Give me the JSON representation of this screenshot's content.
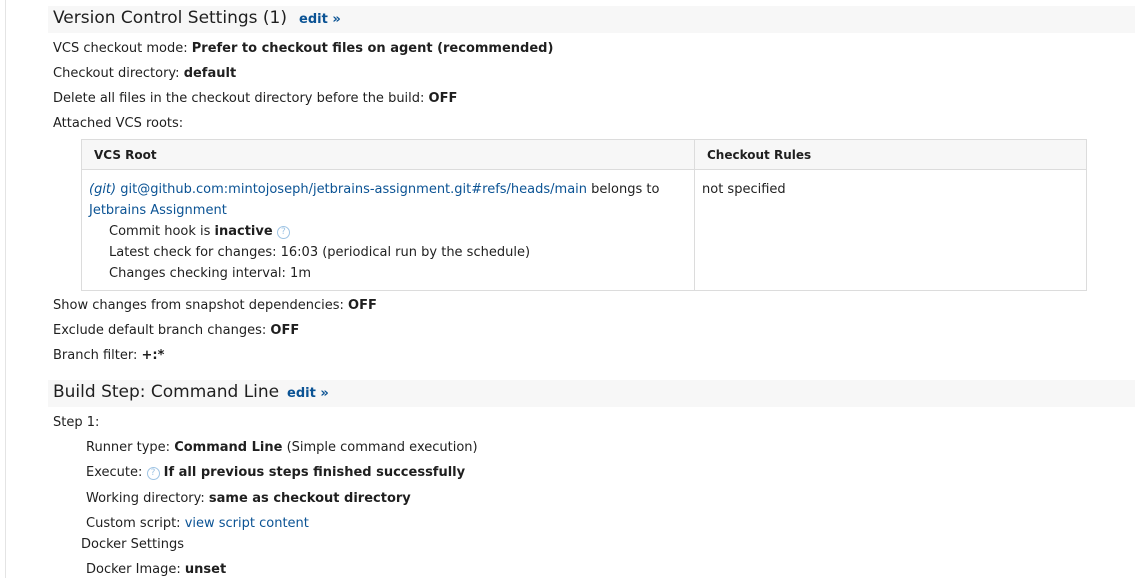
{
  "vcs_section": {
    "title": "Version Control Settings (1)",
    "edit": "edit »",
    "checkout_mode_label": "VCS checkout mode: ",
    "checkout_mode_value": "Prefer to checkout files on agent (recommended)",
    "checkout_dir_label": "Checkout directory: ",
    "checkout_dir_value": "default",
    "delete_files_label": "Delete all files in the checkout directory before the build: ",
    "delete_files_value": "OFF",
    "attached_roots_label": "Attached VCS roots:",
    "table": {
      "col_root": "VCS Root",
      "col_rules": "Checkout Rules",
      "root_type": "(git)",
      "root_url": "git@github.com:mintojoseph/jetbrains-assignment.git#refs/heads/main",
      "belongs_to": " belongs to",
      "project": "Jetbrains Assignment",
      "commit_hook_label": "Commit hook is ",
      "commit_hook_value": "inactive",
      "latest_check": "Latest check for changes: 16:03 (periodical run by the schedule)",
      "interval": "Changes checking interval: 1m",
      "checkout_rules_value": "not specified"
    },
    "snapshot_label": "Show changes from snapshot dependencies: ",
    "snapshot_value": "OFF",
    "exclude_label": "Exclude default branch changes: ",
    "exclude_value": "OFF",
    "branch_filter_label": "Branch filter: ",
    "branch_filter_value": "+:*"
  },
  "build_step": {
    "title": "Build Step: Command Line",
    "edit": "edit »",
    "step_label": "Step 1:",
    "runner_label": "Runner type: ",
    "runner_value": "Command Line",
    "runner_desc": " (Simple command execution)",
    "execute_label": "Execute: ",
    "execute_value": "If all previous steps finished successfully",
    "workdir_label": "Working directory: ",
    "workdir_value": "same as checkout directory",
    "script_label": "Custom script: ",
    "script_link": "view script content",
    "docker_settings": "Docker Settings",
    "docker_image_label": "Docker Image: ",
    "docker_image_value": "unset"
  },
  "icons": {
    "help": "help-circle-icon"
  }
}
